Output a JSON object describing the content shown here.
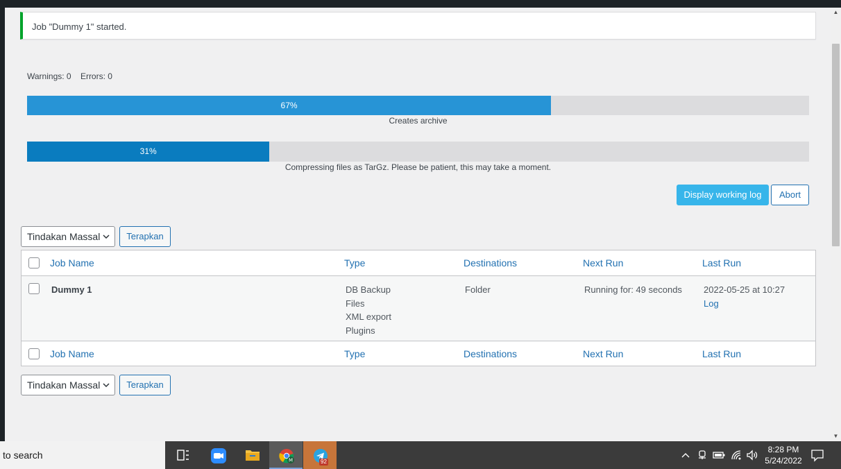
{
  "notice": {
    "text": "Job \"Dummy 1\" started."
  },
  "status": {
    "warnings": "Warnings: 0",
    "errors": "Errors: 0"
  },
  "progress": [
    {
      "percent": 67,
      "label": "67%",
      "step": "Creates archive"
    },
    {
      "percent": 31,
      "label": "31%",
      "step": "Compressing files as TarGz. Please be patient, this may take a moment."
    }
  ],
  "actions": {
    "display_log": "Display working log",
    "abort": "Abort"
  },
  "bulk": {
    "selected": "Tindakan Massal",
    "apply": "Terapkan"
  },
  "table": {
    "columns": [
      "Job Name",
      "Type",
      "Destinations",
      "Next Run",
      "Last Run"
    ],
    "rows": [
      {
        "job_name": "Dummy 1",
        "types": [
          "DB Backup",
          "Files",
          "XML export",
          "Plugins"
        ],
        "destinations": "Folder",
        "next_run": "Running for: 49 seconds",
        "last_run": "2022-05-25 at 10:27",
        "last_run_link": "Log"
      }
    ]
  },
  "taskbar": {
    "search": "to search",
    "telegram_badge": "92",
    "time": "8:28 PM",
    "date": "5/24/2022"
  },
  "colors": {
    "accent": "#2271b1",
    "progress_primary": "#2794d6",
    "progress_secondary": "#0a7cbf",
    "notice_success": "#00a32a",
    "button_primary": "#37b5ea"
  }
}
